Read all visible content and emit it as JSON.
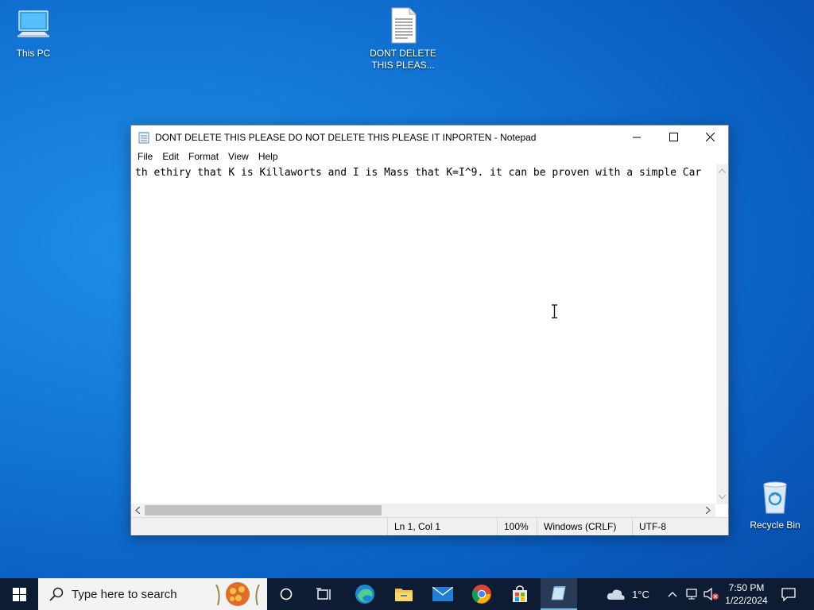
{
  "desktop": {
    "icons": [
      {
        "label": "This PC"
      },
      {
        "label": "DONT DELETE\nTHIS PLEAS..."
      },
      {
        "label": "Recycle Bin"
      }
    ]
  },
  "notepad": {
    "title": "DONT DELETE THIS PLEASE DO NOT DELETE THIS PLEASE IT INPORTEN - Notepad",
    "menu": [
      "File",
      "Edit",
      "Format",
      "View",
      "Help"
    ],
    "content": "th ethiry that K is Killaworts and I is Mass that K=I^9. it can be proven with a simple Car",
    "status": {
      "position": "Ln 1, Col 1",
      "zoom": "100%",
      "line_ending": "Windows (CRLF)",
      "encoding": "UTF-8"
    }
  },
  "taskbar": {
    "search_placeholder": "Type here to search",
    "weather": "1°C",
    "time": "7:50 PM",
    "date": "1/22/2024"
  }
}
